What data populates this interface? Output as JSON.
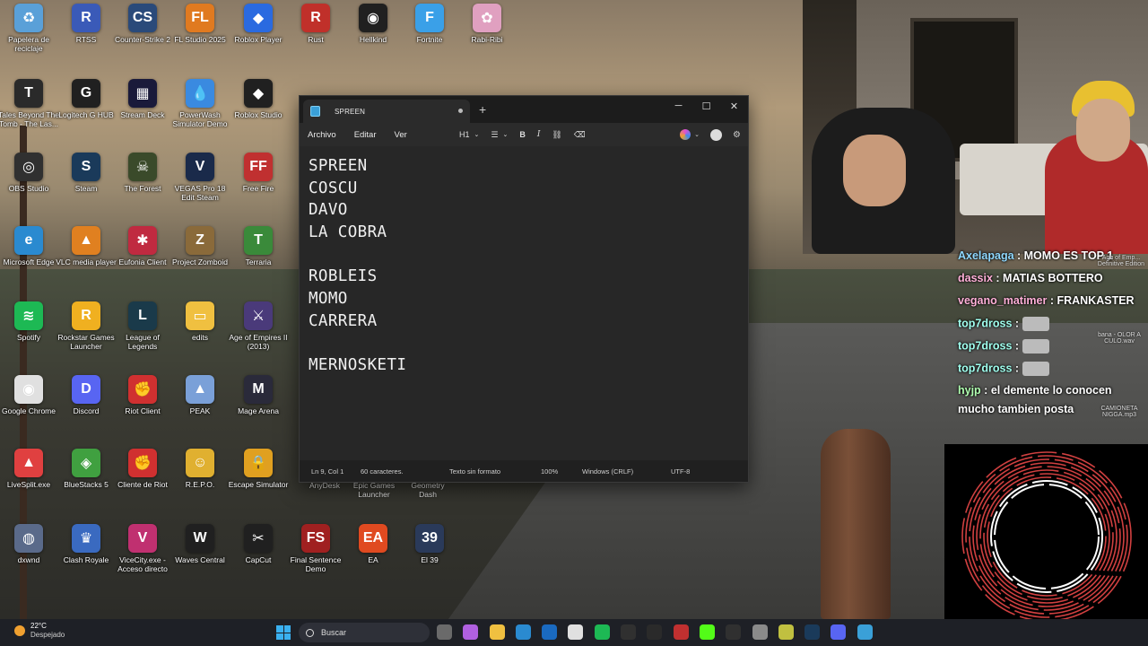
{
  "desktop": {
    "icons": [
      {
        "label": "Papelera de reciclaje",
        "color": "#5aa0d8",
        "glyph": "♻"
      },
      {
        "label": "RTSS",
        "color": "#3a5ab8",
        "glyph": "R"
      },
      {
        "label": "Counter-Strike 2",
        "color": "#2a4a7a",
        "glyph": "CS"
      },
      {
        "label": "FL Studio 2025",
        "color": "#e07a20",
        "glyph": "FL"
      },
      {
        "label": "Roblox Player",
        "color": "#2a6ae0",
        "glyph": "◆"
      },
      {
        "label": "Rust",
        "color": "#c0302a",
        "glyph": "R"
      },
      {
        "label": "Hellkind",
        "color": "#202020",
        "glyph": "◉"
      },
      {
        "label": "Fortnite",
        "color": "#3aa0e8",
        "glyph": "F"
      },
      {
        "label": "Rabi-Ribi",
        "color": "#e0a0c0",
        "glyph": "✿"
      },
      {
        "label": "Tales Beyond The Tomb - The Las...",
        "color": "#2a2a2a",
        "glyph": "T"
      },
      {
        "label": "Logitech G HUB",
        "color": "#202020",
        "glyph": "G"
      },
      {
        "label": "Stream Deck",
        "color": "#1a1a3a",
        "glyph": "▦"
      },
      {
        "label": "PowerWash Simulator Demo",
        "color": "#3a8ae0",
        "glyph": "💧"
      },
      {
        "label": "Roblox Studio",
        "color": "#202020",
        "glyph": "◆"
      },
      {
        "label": "OBS Studio",
        "color": "#303030",
        "glyph": "◎"
      },
      {
        "label": "Steam",
        "color": "#1a3a5a",
        "glyph": "S"
      },
      {
        "label": "The Forest",
        "color": "#3a4a2a",
        "glyph": "☠"
      },
      {
        "label": "VEGAS Pro 18 Edit Steam",
        "color": "#1a2a4a",
        "glyph": "V"
      },
      {
        "label": "Free Fire",
        "color": "#c03030",
        "glyph": "FF"
      },
      {
        "label": "Microsoft Edge",
        "color": "#2a8ad0",
        "glyph": "e"
      },
      {
        "label": "VLC media player",
        "color": "#e08020",
        "glyph": "▲"
      },
      {
        "label": "Eufonia Client",
        "color": "#c02a40",
        "glyph": "✱"
      },
      {
        "label": "Project Zomboid",
        "color": "#8a6a3a",
        "glyph": "Z"
      },
      {
        "label": "Terraria",
        "color": "#3a8a3a",
        "glyph": "T"
      },
      {
        "label": "Spotify",
        "color": "#1db954",
        "glyph": "≋"
      },
      {
        "label": "Rockstar Games Launcher",
        "color": "#f0b020",
        "glyph": "R"
      },
      {
        "label": "League of Legends",
        "color": "#1a3a4a",
        "glyph": "L"
      },
      {
        "label": "edits",
        "color": "#f0c040",
        "glyph": "▭"
      },
      {
        "label": "Age of Empires II (2013)",
        "color": "#4a3a7a",
        "glyph": "⚔"
      },
      {
        "label": "Google Chrome",
        "color": "#e0e0e0",
        "glyph": "◉"
      },
      {
        "label": "Discord",
        "color": "#5865f2",
        "glyph": "D"
      },
      {
        "label": "Riot Client",
        "color": "#d03030",
        "glyph": "✊"
      },
      {
        "label": "PEAK",
        "color": "#7aa0d8",
        "glyph": "▲"
      },
      {
        "label": "Mage Arena",
        "color": "#2a2a3a",
        "glyph": "M"
      },
      {
        "label": "LiveSplit.exe",
        "color": "#e04040",
        "glyph": "▲"
      },
      {
        "label": "BlueStacks 5",
        "color": "#40a040",
        "glyph": "◈"
      },
      {
        "label": "Cliente de Riot",
        "color": "#d03030",
        "glyph": "✊"
      },
      {
        "label": "R.E.P.O.",
        "color": "#e0b030",
        "glyph": "☺"
      },
      {
        "label": "Escape Simulator",
        "color": "#e0a020",
        "glyph": "🔒"
      },
      {
        "label": "dxwnd",
        "color": "#5a6a8a",
        "glyph": "◍"
      },
      {
        "label": "Clash Royale",
        "color": "#3a6ac0",
        "glyph": "♛"
      },
      {
        "label": "ViceCity.exe - Acceso directo",
        "color": "#c03070",
        "glyph": "V"
      },
      {
        "label": "Waves Central",
        "color": "#202020",
        "glyph": "W"
      },
      {
        "label": "CapCut",
        "color": "#202020",
        "glyph": "✂"
      },
      {
        "label": "Final Sentence Demo",
        "color": "#a02020",
        "glyph": "FS"
      },
      {
        "label": "EA",
        "color": "#e04a20",
        "glyph": "EA"
      },
      {
        "label": "El 39",
        "color": "#2a3a5a",
        "glyph": "39"
      }
    ],
    "hidden_labels": [
      "AnyDesk",
      "Epic Games Launcher",
      "Geometry Dash"
    ]
  },
  "notepad": {
    "tab_title": "SPREEN",
    "new_tab": "+",
    "menu": [
      "Archivo",
      "Editar",
      "Ver"
    ],
    "format": {
      "heading": "H1",
      "list": "☰",
      "bold": "B",
      "italic": "I",
      "link": "🔗",
      "clear": "A"
    },
    "lines": [
      "SPREEN",
      "COSCU",
      "DAVO",
      "LA COBRA",
      "",
      "ROBLEIS",
      "MOMO",
      "CARRERA",
      "",
      "MERNOSKETI"
    ],
    "status": {
      "position": "Ln 9, Col 1",
      "chars": "60 caracteres.",
      "format": "Texto sin formato",
      "zoom": "100%",
      "eol": "Windows (CRLF)",
      "encoding": "UTF-8"
    }
  },
  "chat": {
    "messages": [
      {
        "user": "Axelapaga",
        "text": "MOMO ES TOP 1"
      },
      {
        "user": "dassix",
        "text": "MATIAS BOTTERO"
      },
      {
        "user": "vegano_matimer",
        "text": "FRANKASTER"
      },
      {
        "user": "top7dross",
        "text": ""
      },
      {
        "user": "top7dross",
        "text": ""
      },
      {
        "user": "top7dross",
        "text": ""
      },
      {
        "user": "hyjp",
        "text": "el demente lo conocen"
      },
      {
        "user": "",
        "text": "mucho tambien posta"
      }
    ],
    "side_notes": [
      "Age of Emp... Definitive Edition",
      "bana - OLOR A CULO.wav",
      "CAMIONETA NIGGA.mp3"
    ]
  },
  "taskbar": {
    "temp": "22°C",
    "condition": "Despejado",
    "search_placeholder": "Buscar"
  }
}
